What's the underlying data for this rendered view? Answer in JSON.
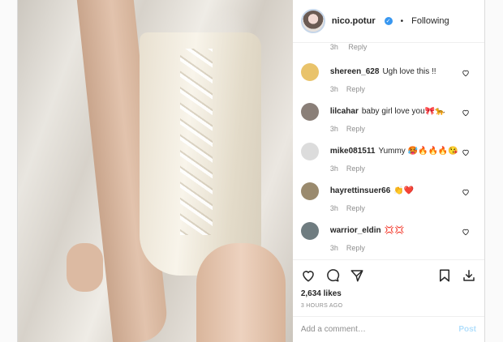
{
  "header": {
    "username": "nico.potur",
    "follow_state": "Following",
    "dot": "•"
  },
  "first_comment_meta": {
    "time": "3h",
    "reply": "Reply"
  },
  "comments": [
    {
      "user": "shereen_628",
      "text": "Ugh love this !!",
      "time": "3h",
      "reply": "Reply",
      "avatar_color": "#e9c36b"
    },
    {
      "user": "lilcahar",
      "text": "baby girl love you🎀🐆",
      "time": "3h",
      "reply": "Reply",
      "avatar_color": "#8a7f78"
    },
    {
      "user": "mike081511",
      "text": "Yummy 🥵🔥🔥🔥😘",
      "time": "3h",
      "reply": "Reply",
      "avatar_color": "#dcdcdc"
    },
    {
      "user": "hayrettinsuer66",
      "text": "👏❤️",
      "time": "3h",
      "reply": "Reply",
      "avatar_color": "#9a8a6e"
    },
    {
      "user": "warrior_eldin",
      "text": "💢💢",
      "time": "3h",
      "reply": "Reply",
      "avatar_color": "#6f7c80"
    }
  ],
  "likes": "2,634 likes",
  "timestamp": "3 HOURS AGO",
  "comment_box": {
    "placeholder": "Add a comment…",
    "post_label": "Post"
  },
  "colors": {
    "accent": "#3897f0",
    "post_disabled": "#b2dffc",
    "muted": "#8e8e8e"
  }
}
